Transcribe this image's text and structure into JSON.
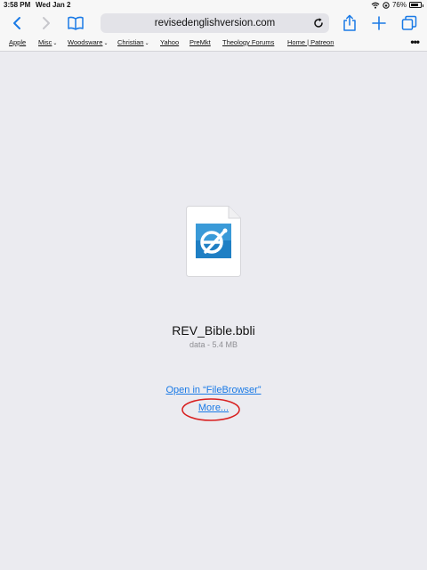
{
  "status": {
    "time": "3:58 PM",
    "date": "Wed Jan 2",
    "battery": "76%",
    "battery_level": 0.76
  },
  "toolbar": {
    "url": "revisedenglishversion.com"
  },
  "bookmarks": [
    {
      "label": "Apple",
      "has_menu": false
    },
    {
      "label": "Misc",
      "has_menu": true
    },
    {
      "label": "Woodsware",
      "has_menu": true
    },
    {
      "label": "Christian",
      "has_menu": true
    },
    {
      "label": "Yahoo",
      "has_menu": false
    },
    {
      "label": "PreMkt",
      "has_menu": false
    },
    {
      "label": "Theology Forums",
      "has_menu": false
    },
    {
      "label": "Home | Patreon",
      "has_menu": false
    }
  ],
  "download": {
    "file_name": "REV_Bible.bbli",
    "meta": "data - 5.4 MB",
    "open_in_label": "Open in “FileBrowser”",
    "more_label": "More..."
  },
  "colors": {
    "accent": "#1a7ae6",
    "annotation": "#d81e1e",
    "page_bg": "#ebebf0"
  }
}
